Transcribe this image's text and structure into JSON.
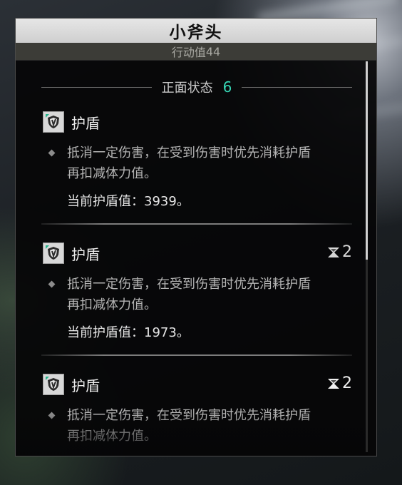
{
  "panel": {
    "title": "小斧头",
    "subtitle_label": "行动值",
    "subtitle_value": "44"
  },
  "section": {
    "label": "正面状态",
    "count": "6"
  },
  "buffs": [
    {
      "name": "护盾",
      "icon": "shield-icon",
      "stack": "",
      "desc_line1": "抵消一定伤害，在受到伤害时优先消耗护盾",
      "desc_line2": "再扣减体力值。",
      "shield_label": "当前护盾值：",
      "shield_value": "3939",
      "shield_end": "。"
    },
    {
      "name": "护盾",
      "icon": "shield-icon",
      "stack": "2",
      "stack_icon": "hourglass-icon",
      "desc_line1": "抵消一定伤害，在受到伤害时优先消耗护盾",
      "desc_line2": "再扣减体力值。",
      "shield_label": "当前护盾值：",
      "shield_value": "1973",
      "shield_end": "。"
    },
    {
      "name": "护盾",
      "icon": "shield-icon",
      "stack": "2",
      "stack_icon": "hourglass-icon",
      "desc_line1": "抵消一定伤害，在受到伤害时优先消耗护盾",
      "desc_line2": "再扣减体力值。"
    }
  ],
  "colors": {
    "accent": "#36d6b4",
    "title_bar": "#dcdcdc",
    "panel_bg": "#060607"
  }
}
